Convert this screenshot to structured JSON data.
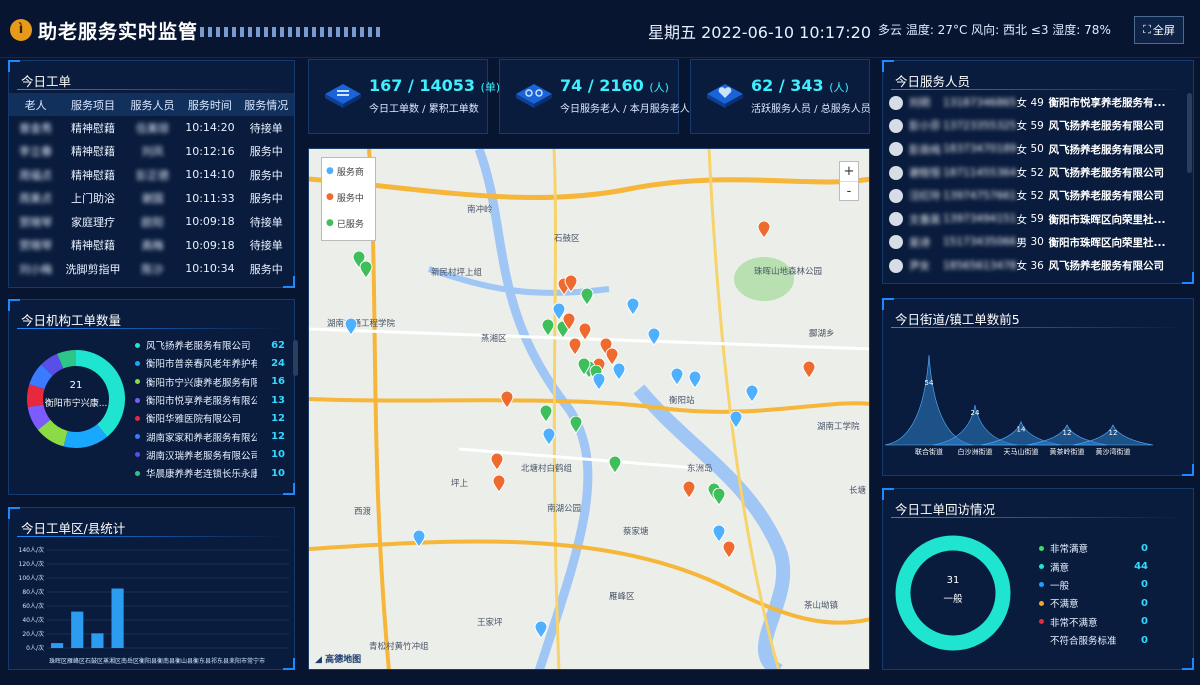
{
  "header": {
    "logo_text": "ì",
    "title": "助老服务实时监管",
    "datetime": "星期五 2022-06-10 10:17:20",
    "weather": "多云  温度: 27°C  风向: 西北 ≤3  湿度: 78%",
    "fullscreen_label": "全屏"
  },
  "stats": [
    {
      "value": "167 / 14053",
      "unit": "(单)",
      "label": "今日工单数 / 累积工单数"
    },
    {
      "value": "74 / 2160",
      "unit": "(人)",
      "label": "今日服务老人 / 本月服务老人"
    },
    {
      "value": "62 / 343",
      "unit": "(人)",
      "label": "活跃服务人员 / 总服务人员"
    }
  ],
  "orders": {
    "title": "今日工单",
    "columns": [
      "老人",
      "服务项目",
      "服务人员",
      "服务时间",
      "服务情况"
    ],
    "rows": [
      {
        "elder": "曾金秀",
        "item": "精神慰藉",
        "staff": "伍美琼",
        "time": "10:14:20",
        "status": "待接单",
        "kind": "wait"
      },
      {
        "elder": "李立春",
        "item": "精神慰藉",
        "staff": "刘凤",
        "time": "10:12:16",
        "status": "服务中",
        "kind": "serv"
      },
      {
        "elder": "周福贞",
        "item": "精神慰藉",
        "staff": "彭正德",
        "time": "10:14:10",
        "status": "服务中",
        "kind": "serv"
      },
      {
        "elder": "周美贞",
        "item": "上门助浴",
        "staff": "谢国",
        "time": "10:11:33",
        "status": "服务中",
        "kind": "serv"
      },
      {
        "elder": "贺晓琴",
        "item": "家庭理疗",
        "staff": "欧阳",
        "time": "10:09:18",
        "status": "待接单",
        "kind": "wait"
      },
      {
        "elder": "贺晓琴",
        "item": "精神慰藉",
        "staff": "高梅",
        "time": "10:09:18",
        "status": "待接单",
        "kind": "wait"
      },
      {
        "elder": "刘小梅",
        "item": "洗脚剪指甲",
        "staff": "陈沙",
        "time": "10:10:34",
        "status": "服务中",
        "kind": "serv"
      }
    ]
  },
  "agency": {
    "title": "今日机构工单数量",
    "donut_center_value": "21",
    "donut_center_label": "衡阳市宁兴康...",
    "items": [
      {
        "name": "风飞扬养老服务有限公司",
        "value": 62,
        "color": "#1fe5d0"
      },
      {
        "name": "衡阳市普亲春风老年养护有...",
        "value": 24,
        "color": "#19a8ff"
      },
      {
        "name": "衡阳市宁兴康养老服务有限公...",
        "value": 16,
        "color": "#8bdc44"
      },
      {
        "name": "衡阳市悦享养老服务有限公司",
        "value": 13,
        "color": "#7d5cff"
      },
      {
        "name": "衡阳华雅医院有限公司",
        "value": 12,
        "color": "#e8293d"
      },
      {
        "name": "湖南家家和养老服务有限公司",
        "value": 12,
        "color": "#3a7bff"
      },
      {
        "name": "湖南汉瑞养老服务有限公司",
        "value": 10,
        "color": "#5a4ee8"
      },
      {
        "name": "华晨康养养老连锁长乐永康...",
        "value": 10,
        "color": "#2cc58a"
      }
    ]
  },
  "district": {
    "title": "今日工单区/县统计",
    "y_ticks": [
      "0人/次",
      "20人/次",
      "40人/次",
      "60人/次",
      "80人/次",
      "100人/次",
      "120人/次",
      "140人/次"
    ],
    "x_label": "珠晖区雁峰区石鼓区蒸湘区南岳区衡阳县衡南县衡山县衡东县祁东县耒阳市常宁市"
  },
  "map": {
    "legend": [
      "服务商",
      "服务中",
      "已服务"
    ],
    "zoom_in": "+",
    "zoom_out": "-",
    "watermark": "高德地图",
    "labels": [
      {
        "text": "石鼓区"
      },
      {
        "text": "珠晖山地森林公园"
      },
      {
        "text": "湖南交通工程学院"
      },
      {
        "text": "蒸湘区"
      },
      {
        "text": "衡阳站"
      },
      {
        "text": "湖南工学院"
      },
      {
        "text": "东洲岛"
      },
      {
        "text": "南湖公园"
      },
      {
        "text": "雁峰区"
      },
      {
        "text": "北塘村白鹤组"
      },
      {
        "text": "新民村坪上组"
      },
      {
        "text": "酃湖乡"
      },
      {
        "text": "南冲岭"
      },
      {
        "text": "坪上"
      },
      {
        "text": "长塘"
      },
      {
        "text": "王家坪"
      },
      {
        "text": "青松村黄竹冲组"
      },
      {
        "text": "蔡家塘"
      },
      {
        "text": "茶山坳镇"
      },
      {
        "text": "西渡"
      }
    ]
  },
  "staff": {
    "title": "今日服务人员",
    "rows": [
      {
        "name": "刘玥",
        "phone": "13187346865",
        "sex": "女",
        "age": "49",
        "org": "衡阳市悦享养老服务有..."
      },
      {
        "name": "彭小芬",
        "phone": "13723355325",
        "sex": "女",
        "age": "59",
        "org": "风飞扬养老服务有限公司"
      },
      {
        "name": "彭良纯",
        "phone": "18373470189",
        "sex": "女",
        "age": "50",
        "org": "风飞扬养老服务有限公司"
      },
      {
        "name": "谢桂恒",
        "phone": "18711455364",
        "sex": "女",
        "age": "52",
        "org": "风飞扬养老服务有限公司"
      },
      {
        "name": "汪红玲",
        "phone": "13974757661",
        "sex": "女",
        "age": "52",
        "org": "风飞扬养老服务有限公司"
      },
      {
        "name": "文香英",
        "phone": "13973494151",
        "sex": "女",
        "age": "59",
        "org": "衡阳市珠晖区向荣里社..."
      },
      {
        "name": "吴诗",
        "phone": "15173435066",
        "sex": "男",
        "age": "30",
        "org": "衡阳市珠晖区向荣里社..."
      },
      {
        "name": "尹女",
        "phone": "18565613478",
        "sex": "女",
        "age": "36",
        "org": "风飞扬养老服务有限公司"
      }
    ]
  },
  "street": {
    "title": "今日街道/镇工单数前5",
    "values_text": [
      "54",
      "24",
      "14",
      "12",
      "12"
    ],
    "names": [
      "联合街道",
      "白沙洲街道",
      "天马山街道",
      "黄茶岭街道",
      "黄沙湾街道"
    ]
  },
  "visit": {
    "title": "今日工单回访情况",
    "donut_center_value": "31",
    "donut_center_label": "一般",
    "items": [
      {
        "name": "非常满意",
        "value": "0",
        "color": "#3ddc6d"
      },
      {
        "name": "满意",
        "value": "44",
        "color": "#1fe5d0"
      },
      {
        "name": "一般",
        "value": "0",
        "color": "#1fa0ff"
      },
      {
        "name": "不满意",
        "value": "0",
        "color": "#f5a623"
      },
      {
        "name": "非常不满意",
        "value": "0",
        "color": "#e8293d"
      },
      {
        "name": "不符合服务标准",
        "value": "0",
        "color": "transparent"
      }
    ]
  },
  "chart_data": [
    {
      "type": "bar",
      "title": "今日工单区/县统计",
      "categories": [
        "珠晖区",
        "雁峰区",
        "石鼓区",
        "蒸湘区",
        "南岳区",
        "衡阳县",
        "衡南县",
        "衡山县",
        "衡东县",
        "祁东县",
        "耒阳市",
        "常宁市"
      ],
      "values": [
        7,
        52,
        21,
        85,
        0,
        0,
        0,
        0,
        0,
        0,
        0,
        0
      ],
      "ylabel": "人/次",
      "ylim": [
        0,
        140
      ],
      "grid": true
    },
    {
      "type": "area",
      "title": "今日街道/镇工单数前5",
      "categories": [
        "联合街道",
        "白沙洲街道",
        "天马山街道",
        "黄茶岭街道",
        "黄沙湾街道"
      ],
      "values": [
        54,
        24,
        14,
        12,
        12
      ]
    },
    {
      "type": "pie",
      "title": "今日机构工单数量",
      "categories": [
        "风飞扬养老服务有限公司",
        "衡阳市普亲春风老年养护有...",
        "衡阳市宁兴康养老服务有限公...",
        "衡阳市悦享养老服务有限公司",
        "衡阳华雅医院有限公司",
        "湖南家家和养老服务有限公司",
        "湖南汉瑞养老服务有限公司",
        "华晨康养养老连锁长乐永康..."
      ],
      "values": [
        62,
        24,
        16,
        13,
        12,
        12,
        10,
        10
      ]
    },
    {
      "type": "pie",
      "title": "今日工单回访情况",
      "categories": [
        "非常满意",
        "满意",
        "一般",
        "不满意",
        "非常不满意",
        "不符合服务标准"
      ],
      "values": [
        0,
        44,
        0,
        0,
        0,
        0
      ]
    }
  ]
}
